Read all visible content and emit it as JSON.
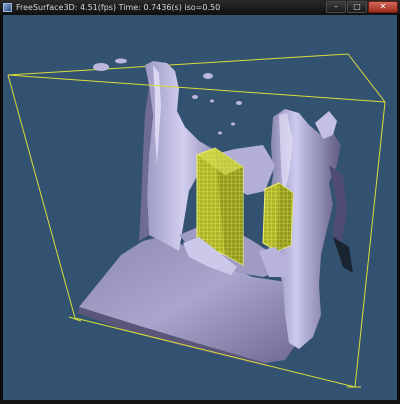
{
  "window": {
    "title": "FreeSurface3D: 4.51(fps)  Time: 0.7436(s)  iso=0.50",
    "controls": {
      "minimize": "–",
      "maximize": "□",
      "close": "✕"
    }
  },
  "scene": {
    "background_color": "#335170",
    "box_edge_color": "#d8dd3c",
    "fluid_color": "#a7a3c8",
    "obstacle_color": "#cfd63a"
  }
}
